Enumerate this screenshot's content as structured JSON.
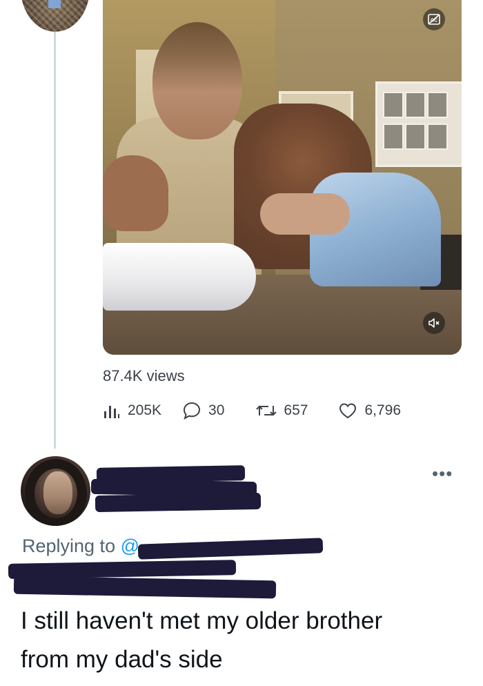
{
  "colors": {
    "text_primary": "#0f1419",
    "text_secondary": "#536471",
    "link": "#1d9bf0",
    "thread_line": "#cfd9de",
    "redaction": "#1d1a3a"
  },
  "video": {
    "cc_icon": "closed-captions-icon",
    "mute_icon": "volume-muted-icon",
    "views_text": "87.4K views"
  },
  "actions": {
    "analytics": {
      "icon": "analytics-bars-icon",
      "count": "205K"
    },
    "reply": {
      "icon": "reply-bubble-icon",
      "count": "30"
    },
    "retweet": {
      "icon": "retweet-icon",
      "count": "657"
    },
    "like": {
      "icon": "heart-icon",
      "count": "6,796"
    }
  },
  "reply_tweet": {
    "more_icon": "ellipsis-icon",
    "more_text": "•••",
    "replying_label": "Replying to ",
    "replying_at": "@",
    "text": "I still haven't met my older brother\nfrom my dad's side"
  }
}
